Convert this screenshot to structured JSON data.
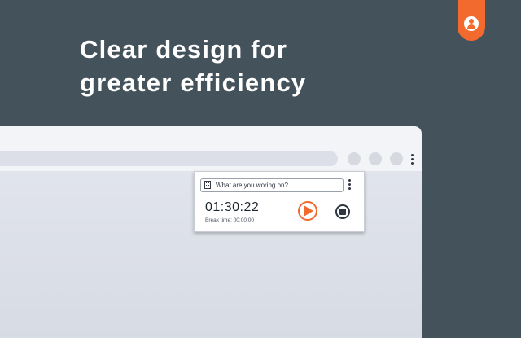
{
  "headline": {
    "line1": "Clear design for",
    "line2": "greater efficiency"
  },
  "badge": {
    "icon": "user-pin-icon",
    "color": "#f26a2e"
  },
  "colors": {
    "background": "#44525c",
    "accent": "#f26a2e",
    "browser_chrome": "#f3f4f8",
    "viewport": "#d9dde6"
  },
  "browser": {
    "address_bar": {
      "icon": "address-bar"
    },
    "toolbar_buttons": [
      "toolbar-button",
      "toolbar-button",
      "toolbar-button"
    ],
    "menu_icon": "kebab-menu-icon"
  },
  "timer_popup": {
    "task_input": {
      "placeholder": "What are you woring on?",
      "icon": "building-icon"
    },
    "menu_icon": "kebab-menu-icon",
    "elapsed": "01:30:22",
    "break_time": "Break time: 00:00:00",
    "play_icon": "play-icon",
    "stop_icon": "stop-icon"
  }
}
